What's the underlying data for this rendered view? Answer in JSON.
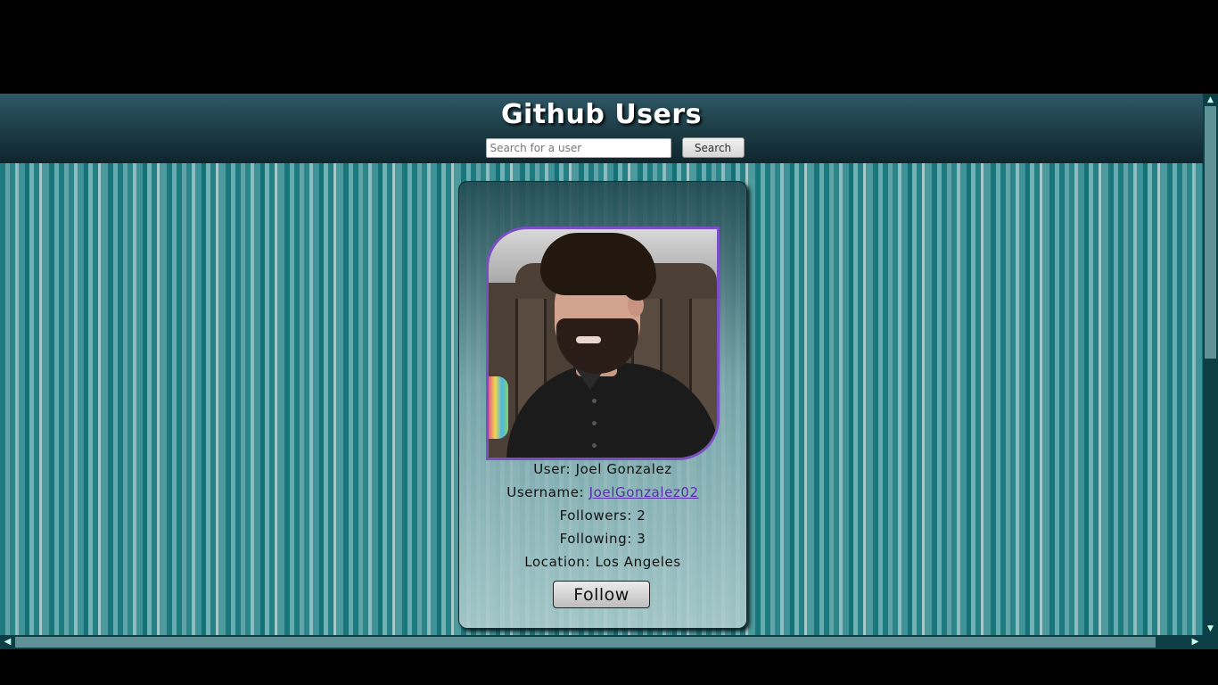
{
  "header": {
    "title": "Github Users",
    "search_placeholder": "Search for a user",
    "search_value": "",
    "search_button_label": "Search"
  },
  "profile": {
    "user_label": "User:",
    "user_name": "Joel Gonzalez",
    "username_label": "Username:",
    "username": "JoelGonzalez02",
    "followers_label": "Followers:",
    "followers": "2",
    "following_label": "Following:",
    "following": "3",
    "location_label": "Location:",
    "location": "Los Angeles",
    "follow_button_label": "Follow"
  },
  "scrollbars": {
    "up_icon": "chevron-up-icon",
    "down_icon": "chevron-down-icon",
    "left_icon": "chevron-left-icon",
    "right_icon": "chevron-right-icon"
  },
  "colors": {
    "accent_purple": "#7a4fc6",
    "link": "#5a2db0",
    "header_dark": "#1c3b45",
    "teal_stripe": "#1d7a7f"
  }
}
